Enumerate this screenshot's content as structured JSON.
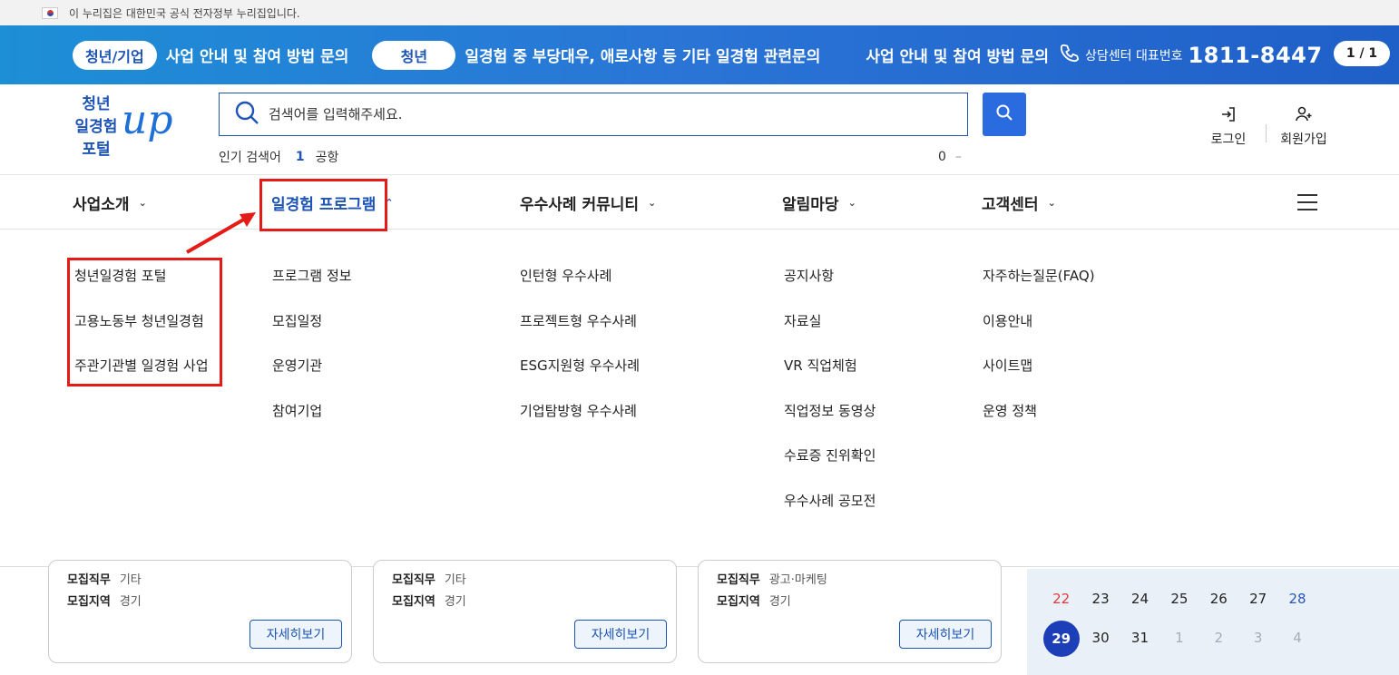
{
  "gov_bar": {
    "text": "이 누리집은 대한민국 공식 전자정부 누리집입니다."
  },
  "banner": {
    "pill1": "청년/기업",
    "text1": "사업 안내 및 참여 방법 문의",
    "pill2": "청년",
    "text2": "일경험 중 부당대우, 애로사항 등 기타 일경험 관련문의",
    "text3": "사업 안내 및 참여 방법 문의",
    "phone_label": "상담센터 대표번호",
    "phone_number": "1811-8447",
    "pager": "1 / 1"
  },
  "logo": {
    "line1": "청년",
    "line2": "일경험",
    "line3": "포털",
    "up": "up"
  },
  "search": {
    "placeholder": "검색어를 입력해주세요.",
    "popular_label": "인기 검색어",
    "popular_rank": "1",
    "popular_term": "공항",
    "right_count": "0",
    "right_dash": "–"
  },
  "user_menu": {
    "login": "로그인",
    "signup": "회원가입"
  },
  "gnb": [
    {
      "label": "사업소개"
    },
    {
      "label": "일경험 프로그램"
    },
    {
      "label": "우수사례 커뮤니티"
    },
    {
      "label": "알림마당"
    },
    {
      "label": "고객센터"
    }
  ],
  "mega": {
    "col1": [
      "청년일경험 포털",
      "고용노동부 청년일경험",
      "주관기관별 일경험 사업"
    ],
    "col2": [
      "프로그램 정보",
      "모집일정",
      "운영기관",
      "참여기업"
    ],
    "col3": [
      "인턴형 우수사례",
      "프로젝트형 우수사례",
      "ESG지원형 우수사례",
      "기업탐방형 우수사례"
    ],
    "col4": [
      "공지사항",
      "자료실",
      "VR 직업체험",
      "직업정보 동영상",
      "수료증 진위확인",
      "우수사례 공모전"
    ],
    "col5": [
      "자주하는질문(FAQ)",
      "이용안내",
      "사이트맵",
      "운영 정책"
    ]
  },
  "cards": [
    {
      "job_label": "모집직무",
      "job": "기타",
      "region_label": "모집지역",
      "region": "경기",
      "button": "자세히보기"
    },
    {
      "job_label": "모집직무",
      "job": "기타",
      "region_label": "모집지역",
      "region": "경기",
      "button": "자세히보기"
    },
    {
      "job_label": "모집직무",
      "job": "광고·마케팅",
      "region_label": "모집지역",
      "region": "경기",
      "button": "자세히보기"
    }
  ],
  "calendar": {
    "week1": [
      "22",
      "23",
      "24",
      "25",
      "26",
      "27",
      "28"
    ],
    "week2": [
      "29",
      "30",
      "31",
      "1",
      "2",
      "3",
      "4"
    ]
  },
  "colors": {
    "primary": "#1e54b4",
    "banner": "#2a74d6",
    "highlight": "#e41b17"
  }
}
